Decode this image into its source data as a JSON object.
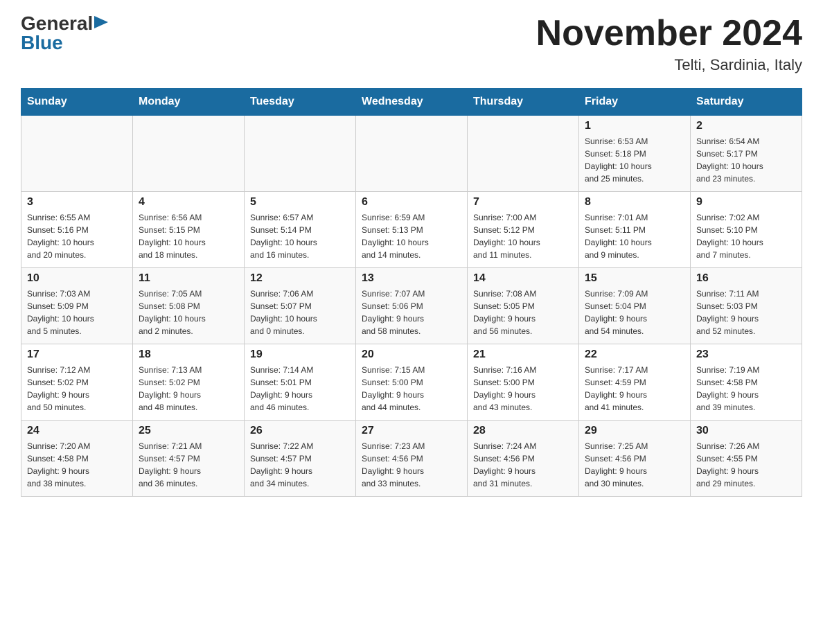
{
  "header": {
    "logo": {
      "general": "General",
      "blue": "Blue",
      "arrow": "▶"
    },
    "title": "November 2024",
    "subtitle": "Telti, Sardinia, Italy"
  },
  "days_of_week": [
    "Sunday",
    "Monday",
    "Tuesday",
    "Wednesday",
    "Thursday",
    "Friday",
    "Saturday"
  ],
  "weeks": [
    {
      "days": [
        {
          "num": "",
          "info": ""
        },
        {
          "num": "",
          "info": ""
        },
        {
          "num": "",
          "info": ""
        },
        {
          "num": "",
          "info": ""
        },
        {
          "num": "",
          "info": ""
        },
        {
          "num": "1",
          "info": "Sunrise: 6:53 AM\nSunset: 5:18 PM\nDaylight: 10 hours\nand 25 minutes."
        },
        {
          "num": "2",
          "info": "Sunrise: 6:54 AM\nSunset: 5:17 PM\nDaylight: 10 hours\nand 23 minutes."
        }
      ]
    },
    {
      "days": [
        {
          "num": "3",
          "info": "Sunrise: 6:55 AM\nSunset: 5:16 PM\nDaylight: 10 hours\nand 20 minutes."
        },
        {
          "num": "4",
          "info": "Sunrise: 6:56 AM\nSunset: 5:15 PM\nDaylight: 10 hours\nand 18 minutes."
        },
        {
          "num": "5",
          "info": "Sunrise: 6:57 AM\nSunset: 5:14 PM\nDaylight: 10 hours\nand 16 minutes."
        },
        {
          "num": "6",
          "info": "Sunrise: 6:59 AM\nSunset: 5:13 PM\nDaylight: 10 hours\nand 14 minutes."
        },
        {
          "num": "7",
          "info": "Sunrise: 7:00 AM\nSunset: 5:12 PM\nDaylight: 10 hours\nand 11 minutes."
        },
        {
          "num": "8",
          "info": "Sunrise: 7:01 AM\nSunset: 5:11 PM\nDaylight: 10 hours\nand 9 minutes."
        },
        {
          "num": "9",
          "info": "Sunrise: 7:02 AM\nSunset: 5:10 PM\nDaylight: 10 hours\nand 7 minutes."
        }
      ]
    },
    {
      "days": [
        {
          "num": "10",
          "info": "Sunrise: 7:03 AM\nSunset: 5:09 PM\nDaylight: 10 hours\nand 5 minutes."
        },
        {
          "num": "11",
          "info": "Sunrise: 7:05 AM\nSunset: 5:08 PM\nDaylight: 10 hours\nand 2 minutes."
        },
        {
          "num": "12",
          "info": "Sunrise: 7:06 AM\nSunset: 5:07 PM\nDaylight: 10 hours\nand 0 minutes."
        },
        {
          "num": "13",
          "info": "Sunrise: 7:07 AM\nSunset: 5:06 PM\nDaylight: 9 hours\nand 58 minutes."
        },
        {
          "num": "14",
          "info": "Sunrise: 7:08 AM\nSunset: 5:05 PM\nDaylight: 9 hours\nand 56 minutes."
        },
        {
          "num": "15",
          "info": "Sunrise: 7:09 AM\nSunset: 5:04 PM\nDaylight: 9 hours\nand 54 minutes."
        },
        {
          "num": "16",
          "info": "Sunrise: 7:11 AM\nSunset: 5:03 PM\nDaylight: 9 hours\nand 52 minutes."
        }
      ]
    },
    {
      "days": [
        {
          "num": "17",
          "info": "Sunrise: 7:12 AM\nSunset: 5:02 PM\nDaylight: 9 hours\nand 50 minutes."
        },
        {
          "num": "18",
          "info": "Sunrise: 7:13 AM\nSunset: 5:02 PM\nDaylight: 9 hours\nand 48 minutes."
        },
        {
          "num": "19",
          "info": "Sunrise: 7:14 AM\nSunset: 5:01 PM\nDaylight: 9 hours\nand 46 minutes."
        },
        {
          "num": "20",
          "info": "Sunrise: 7:15 AM\nSunset: 5:00 PM\nDaylight: 9 hours\nand 44 minutes."
        },
        {
          "num": "21",
          "info": "Sunrise: 7:16 AM\nSunset: 5:00 PM\nDaylight: 9 hours\nand 43 minutes."
        },
        {
          "num": "22",
          "info": "Sunrise: 7:17 AM\nSunset: 4:59 PM\nDaylight: 9 hours\nand 41 minutes."
        },
        {
          "num": "23",
          "info": "Sunrise: 7:19 AM\nSunset: 4:58 PM\nDaylight: 9 hours\nand 39 minutes."
        }
      ]
    },
    {
      "days": [
        {
          "num": "24",
          "info": "Sunrise: 7:20 AM\nSunset: 4:58 PM\nDaylight: 9 hours\nand 38 minutes."
        },
        {
          "num": "25",
          "info": "Sunrise: 7:21 AM\nSunset: 4:57 PM\nDaylight: 9 hours\nand 36 minutes."
        },
        {
          "num": "26",
          "info": "Sunrise: 7:22 AM\nSunset: 4:57 PM\nDaylight: 9 hours\nand 34 minutes."
        },
        {
          "num": "27",
          "info": "Sunrise: 7:23 AM\nSunset: 4:56 PM\nDaylight: 9 hours\nand 33 minutes."
        },
        {
          "num": "28",
          "info": "Sunrise: 7:24 AM\nSunset: 4:56 PM\nDaylight: 9 hours\nand 31 minutes."
        },
        {
          "num": "29",
          "info": "Sunrise: 7:25 AM\nSunset: 4:56 PM\nDaylight: 9 hours\nand 30 minutes."
        },
        {
          "num": "30",
          "info": "Sunrise: 7:26 AM\nSunset: 4:55 PM\nDaylight: 9 hours\nand 29 minutes."
        }
      ]
    }
  ]
}
